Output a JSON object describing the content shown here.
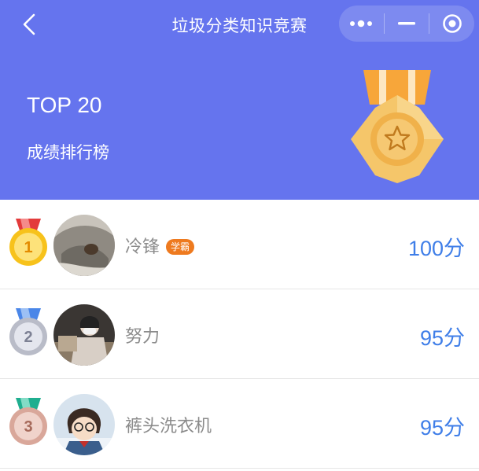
{
  "nav": {
    "title": "垃圾分类知识竞赛"
  },
  "banner": {
    "heading": "TOP 20",
    "subheading": "成绩排行榜"
  },
  "leaderboard": [
    {
      "rank": "1",
      "name": "冷锋",
      "badge": "学霸",
      "score": "100分"
    },
    {
      "rank": "2",
      "name": "努力",
      "badge": "",
      "score": "95分"
    },
    {
      "rank": "3",
      "name": "裤头洗衣机",
      "badge": "",
      "score": "95分"
    }
  ],
  "colors": {
    "header_bg": "#6574ee",
    "score": "#3f7ee8",
    "badge": "#ee7a1f"
  }
}
